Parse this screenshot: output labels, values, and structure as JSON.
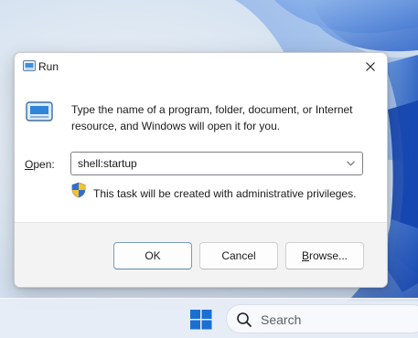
{
  "dialog": {
    "title": "Run",
    "description": "Type the name of a program, folder, document, or Internet resource, and Windows will open it for you.",
    "open_label_accel": "O",
    "open_label_rest": "pen:",
    "open_value": "shell:startup",
    "privilege_note": "This task will be created with administrative privileges.",
    "buttons": {
      "ok": "OK",
      "cancel": "Cancel",
      "browse_accel": "B",
      "browse_rest": "rowse..."
    }
  },
  "taskbar": {
    "search_placeholder": "Search"
  },
  "icons": {
    "title": "run-app-icon",
    "close": "close-icon",
    "run": "run-app-icon",
    "dropdown": "chevron-down-icon",
    "shield": "uac-shield-icon",
    "start": "windows-logo-icon",
    "search": "search-icon"
  },
  "colors": {
    "accent_blue": "#1a6fd1",
    "ok_button_border": "#7a9dbd",
    "dialog_footer": "#f3f3f3"
  }
}
